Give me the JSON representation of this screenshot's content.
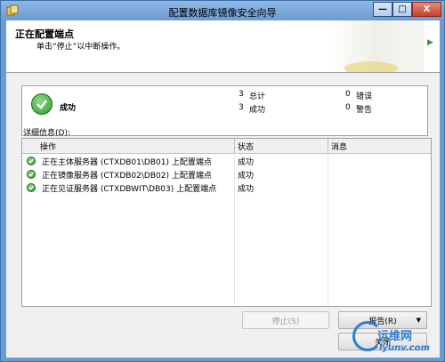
{
  "window": {
    "title": "配置数据库镜像安全向导",
    "min_label": "—",
    "max_label": "□",
    "close_label": "X"
  },
  "header": {
    "title": "正在配置端点",
    "subtitle": "单击“停止”以中断操作。",
    "arrow": "▶"
  },
  "summary": {
    "status": "成功",
    "total_count": "3",
    "total_label": "总计",
    "success_count": "3",
    "success_label": "成功",
    "error_count": "0",
    "error_label": "错误",
    "warning_count": "0",
    "warning_label": "警告"
  },
  "details": {
    "label": "详细信息(D):",
    "columns": [
      "操作",
      "状态",
      "消息"
    ],
    "rows": [
      {
        "action": "正在主体服务器 (CTXDB01\\DB01) 上配置端点",
        "status": "成功",
        "message": ""
      },
      {
        "action": "正在镜像服务器 (CTXDB02\\DB02) 上配置端点",
        "status": "成功",
        "message": ""
      },
      {
        "action": "正在见证服务器 (CTXDBWIT\\DB03) 上配置端点",
        "status": "成功",
        "message": ""
      }
    ]
  },
  "buttons": {
    "stop": "停止(S)",
    "report": "报告(R)",
    "report_arrow": "▼",
    "close": "关闭"
  },
  "watermark": {
    "brand": "运维网",
    "url": "iyunv.com"
  },
  "colors": {
    "titlebar": "#6c9bd0",
    "success_green": "#2f9e2f",
    "watermark_blue": "#2b7fd1"
  }
}
